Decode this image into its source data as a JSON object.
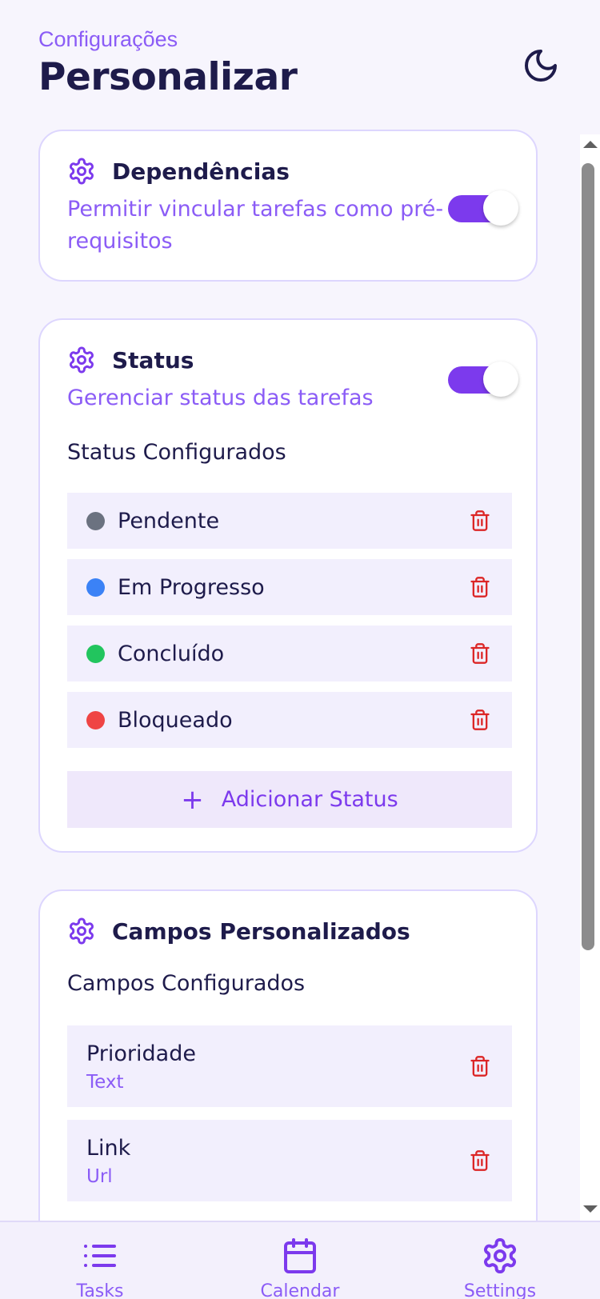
{
  "header": {
    "breadcrumb": "Configurações",
    "title": "Personalizar",
    "theme_icon": "moon-icon"
  },
  "dependencies_card": {
    "title": "Dependências",
    "description_line1": "Permitir vincular tarefas como pré-",
    "description_line2": "requisitos",
    "enabled": true
  },
  "status_card": {
    "title": "Status",
    "description": "Gerenciar status das tarefas",
    "enabled": true,
    "section_label": "Status Configurados",
    "items": [
      {
        "label": "Pendente",
        "color": "#6b7280"
      },
      {
        "label": "Em Progresso",
        "color": "#3b82f6"
      },
      {
        "label": "Concluído",
        "color": "#22c55e"
      },
      {
        "label": "Bloqueado",
        "color": "#ef4444"
      }
    ],
    "add_button": "Adicionar Status"
  },
  "custom_fields_card": {
    "title": "Campos Personalizados",
    "section_label": "Campos Configurados",
    "fields": [
      {
        "name": "Prioridade",
        "type": "Text"
      },
      {
        "name": "Link",
        "type": "Url"
      }
    ]
  },
  "bottom_nav": {
    "items": [
      {
        "label": "Tasks",
        "icon": "list-icon"
      },
      {
        "label": "Calendar",
        "icon": "calendar-icon"
      },
      {
        "label": "Settings",
        "icon": "gear-icon"
      }
    ]
  },
  "colors": {
    "accent": "#7c3aed",
    "accent_light": "#8b5cf6",
    "delete": "#dc2626",
    "background": "#f7f5fd"
  }
}
